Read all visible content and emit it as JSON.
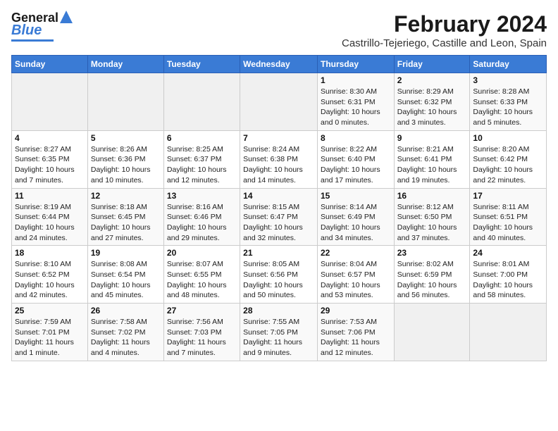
{
  "header": {
    "logo_line1": "General",
    "logo_line2": "Blue",
    "title": "February 2024",
    "subtitle": "Castrillo-Tejeriego, Castille and Leon, Spain"
  },
  "days_of_week": [
    "Sunday",
    "Monday",
    "Tuesday",
    "Wednesday",
    "Thursday",
    "Friday",
    "Saturday"
  ],
  "weeks": [
    [
      {
        "day": "",
        "info": ""
      },
      {
        "day": "",
        "info": ""
      },
      {
        "day": "",
        "info": ""
      },
      {
        "day": "",
        "info": ""
      },
      {
        "day": "1",
        "info": "Sunrise: 8:30 AM\nSunset: 6:31 PM\nDaylight: 10 hours\nand 0 minutes."
      },
      {
        "day": "2",
        "info": "Sunrise: 8:29 AM\nSunset: 6:32 PM\nDaylight: 10 hours\nand 3 minutes."
      },
      {
        "day": "3",
        "info": "Sunrise: 8:28 AM\nSunset: 6:33 PM\nDaylight: 10 hours\nand 5 minutes."
      }
    ],
    [
      {
        "day": "4",
        "info": "Sunrise: 8:27 AM\nSunset: 6:35 PM\nDaylight: 10 hours\nand 7 minutes."
      },
      {
        "day": "5",
        "info": "Sunrise: 8:26 AM\nSunset: 6:36 PM\nDaylight: 10 hours\nand 10 minutes."
      },
      {
        "day": "6",
        "info": "Sunrise: 8:25 AM\nSunset: 6:37 PM\nDaylight: 10 hours\nand 12 minutes."
      },
      {
        "day": "7",
        "info": "Sunrise: 8:24 AM\nSunset: 6:38 PM\nDaylight: 10 hours\nand 14 minutes."
      },
      {
        "day": "8",
        "info": "Sunrise: 8:22 AM\nSunset: 6:40 PM\nDaylight: 10 hours\nand 17 minutes."
      },
      {
        "day": "9",
        "info": "Sunrise: 8:21 AM\nSunset: 6:41 PM\nDaylight: 10 hours\nand 19 minutes."
      },
      {
        "day": "10",
        "info": "Sunrise: 8:20 AM\nSunset: 6:42 PM\nDaylight: 10 hours\nand 22 minutes."
      }
    ],
    [
      {
        "day": "11",
        "info": "Sunrise: 8:19 AM\nSunset: 6:44 PM\nDaylight: 10 hours\nand 24 minutes."
      },
      {
        "day": "12",
        "info": "Sunrise: 8:18 AM\nSunset: 6:45 PM\nDaylight: 10 hours\nand 27 minutes."
      },
      {
        "day": "13",
        "info": "Sunrise: 8:16 AM\nSunset: 6:46 PM\nDaylight: 10 hours\nand 29 minutes."
      },
      {
        "day": "14",
        "info": "Sunrise: 8:15 AM\nSunset: 6:47 PM\nDaylight: 10 hours\nand 32 minutes."
      },
      {
        "day": "15",
        "info": "Sunrise: 8:14 AM\nSunset: 6:49 PM\nDaylight: 10 hours\nand 34 minutes."
      },
      {
        "day": "16",
        "info": "Sunrise: 8:12 AM\nSunset: 6:50 PM\nDaylight: 10 hours\nand 37 minutes."
      },
      {
        "day": "17",
        "info": "Sunrise: 8:11 AM\nSunset: 6:51 PM\nDaylight: 10 hours\nand 40 minutes."
      }
    ],
    [
      {
        "day": "18",
        "info": "Sunrise: 8:10 AM\nSunset: 6:52 PM\nDaylight: 10 hours\nand 42 minutes."
      },
      {
        "day": "19",
        "info": "Sunrise: 8:08 AM\nSunset: 6:54 PM\nDaylight: 10 hours\nand 45 minutes."
      },
      {
        "day": "20",
        "info": "Sunrise: 8:07 AM\nSunset: 6:55 PM\nDaylight: 10 hours\nand 48 minutes."
      },
      {
        "day": "21",
        "info": "Sunrise: 8:05 AM\nSunset: 6:56 PM\nDaylight: 10 hours\nand 50 minutes."
      },
      {
        "day": "22",
        "info": "Sunrise: 8:04 AM\nSunset: 6:57 PM\nDaylight: 10 hours\nand 53 minutes."
      },
      {
        "day": "23",
        "info": "Sunrise: 8:02 AM\nSunset: 6:59 PM\nDaylight: 10 hours\nand 56 minutes."
      },
      {
        "day": "24",
        "info": "Sunrise: 8:01 AM\nSunset: 7:00 PM\nDaylight: 10 hours\nand 58 minutes."
      }
    ],
    [
      {
        "day": "25",
        "info": "Sunrise: 7:59 AM\nSunset: 7:01 PM\nDaylight: 11 hours\nand 1 minute."
      },
      {
        "day": "26",
        "info": "Sunrise: 7:58 AM\nSunset: 7:02 PM\nDaylight: 11 hours\nand 4 minutes."
      },
      {
        "day": "27",
        "info": "Sunrise: 7:56 AM\nSunset: 7:03 PM\nDaylight: 11 hours\nand 7 minutes."
      },
      {
        "day": "28",
        "info": "Sunrise: 7:55 AM\nSunset: 7:05 PM\nDaylight: 11 hours\nand 9 minutes."
      },
      {
        "day": "29",
        "info": "Sunrise: 7:53 AM\nSunset: 7:06 PM\nDaylight: 11 hours\nand 12 minutes."
      },
      {
        "day": "",
        "info": ""
      },
      {
        "day": "",
        "info": ""
      }
    ]
  ]
}
